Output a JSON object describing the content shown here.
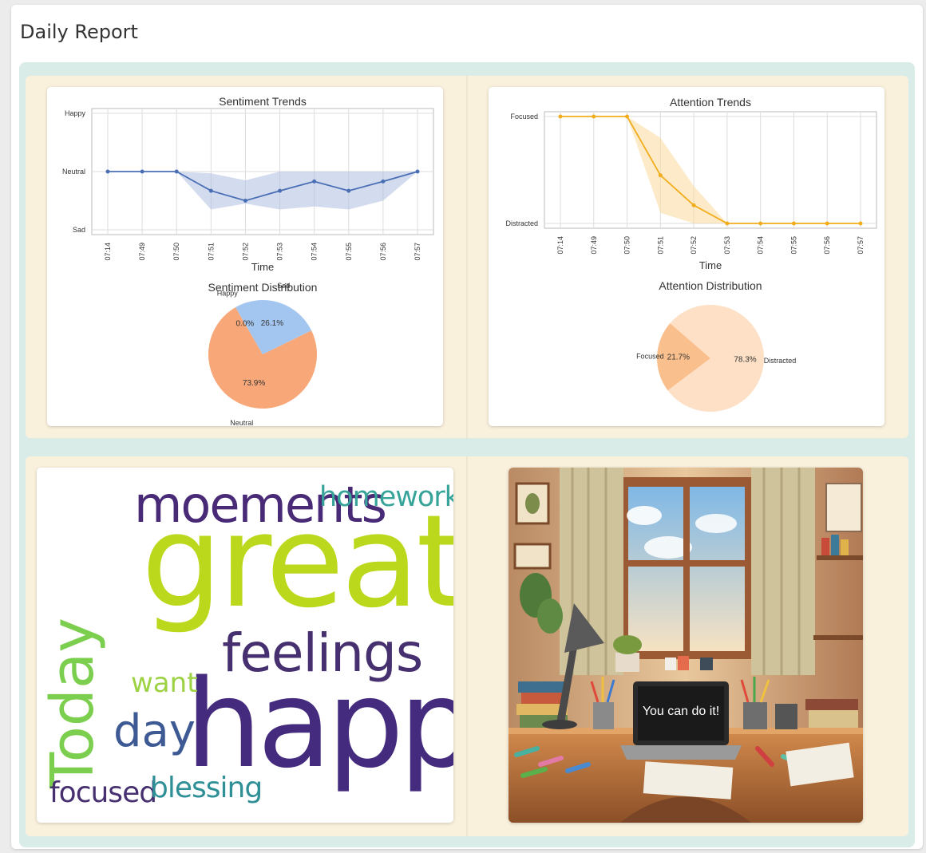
{
  "page": {
    "title": "Daily Report"
  },
  "colors": {
    "sentiment_line": "#4a6fb5",
    "sentiment_band": "#aebde0",
    "attention_line": "#f2ad1d",
    "attention_band": "#f9d99a",
    "pie_neutral": "#f8a878",
    "pie_sad": "#a3c6f0",
    "pie_focused": "#f9c08e",
    "pie_distracted": "#fde0c5"
  },
  "chart_data": [
    {
      "id": "sentiment_trends",
      "type": "line",
      "title": "Sentiment Trends",
      "xlabel": "Time",
      "ylabel": "",
      "x": [
        "07:14",
        "07:49",
        "07:50",
        "07:51",
        "07:52",
        "07:53",
        "07:54",
        "07:55",
        "07:56",
        "07:57"
      ],
      "yticks": [
        "Sad",
        "Neutral",
        "Happy"
      ],
      "ylim": [
        -1,
        1
      ],
      "values": [
        0,
        0,
        0,
        -0.33,
        -0.5,
        -0.33,
        -0.17,
        -0.33,
        -0.17,
        0
      ],
      "band_lower": [
        0,
        0,
        0,
        -0.65,
        -0.55,
        -0.65,
        -0.6,
        -0.65,
        -0.5,
        0
      ],
      "band_upper": [
        0,
        0,
        0,
        -0.03,
        -0.15,
        0,
        0,
        0,
        0,
        0
      ],
      "grid": true
    },
    {
      "id": "attention_trends",
      "type": "line",
      "title": "Attention Trends",
      "xlabel": "Time",
      "ylabel": "",
      "x": [
        "07:14",
        "07:49",
        "07:50",
        "07:51",
        "07:52",
        "07:53",
        "07:54",
        "07:55",
        "07:56",
        "07:57"
      ],
      "yticks": [
        "Distracted",
        "Focused"
      ],
      "ylim": [
        0,
        1
      ],
      "values": [
        1,
        1,
        1,
        0.45,
        0.17,
        0,
        0,
        0,
        0,
        0
      ],
      "band_lower": [
        1,
        1,
        1,
        0.1,
        0,
        0,
        0,
        0,
        0,
        0
      ],
      "band_upper": [
        1,
        1,
        1,
        0.8,
        0.35,
        0,
        0,
        0,
        0,
        0
      ],
      "grid": true
    },
    {
      "id": "sentiment_distribution",
      "type": "pie",
      "title": "Sentiment Distribution",
      "slices": [
        {
          "label": "Neutral",
          "value": 73.9,
          "display": "73.9%"
        },
        {
          "label": "Sad",
          "value": 26.1,
          "display": "26.1%"
        },
        {
          "label": "Happy",
          "value": 0.0,
          "display": "0.0%"
        }
      ]
    },
    {
      "id": "attention_distribution",
      "type": "pie",
      "title": "Attention Distribution",
      "slices": [
        {
          "label": "Focused",
          "value": 21.7,
          "display": "21.7%"
        },
        {
          "label": "Distracted",
          "value": 78.3,
          "display": "78.3%"
        }
      ]
    }
  ],
  "word_cloud": {
    "words": [
      {
        "text": "great",
        "color": "#bcd81c"
      },
      {
        "text": "happy",
        "color": "#442b7e"
      },
      {
        "text": "Today",
        "color": "#7ccf4e"
      },
      {
        "text": "moements",
        "color": "#482a77"
      },
      {
        "text": "feelings",
        "color": "#46306f"
      },
      {
        "text": "homeworks",
        "color": "#37a49a"
      },
      {
        "text": "day",
        "color": "#3e5a94"
      },
      {
        "text": "want",
        "color": "#9dd245"
      },
      {
        "text": "focused",
        "color": "#46306f"
      },
      {
        "text": "blessing",
        "color": "#2f8f96"
      }
    ]
  },
  "illustration": {
    "laptop_text": "You can do it!"
  }
}
